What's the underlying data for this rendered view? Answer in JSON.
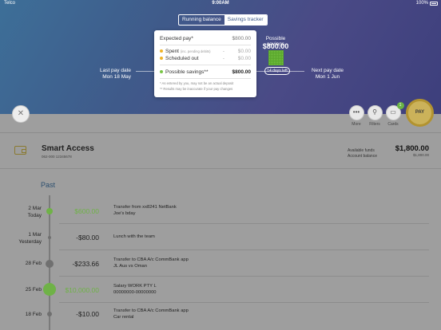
{
  "status_bar": {
    "carrier": "Telco",
    "time": "9:00AM",
    "battery": "100%"
  },
  "segments": [
    {
      "label": "Running balance"
    },
    {
      "label": "Savings tracker"
    }
  ],
  "tracker": {
    "last_pay": {
      "title": "Last pay date",
      "date": "Mon 18 May"
    },
    "next_pay": {
      "title": "Next pay date",
      "date": "Mon 1 Jun"
    },
    "days_left": "14 days left",
    "savings_title": "Possible savings",
    "savings_amount": "$800.00"
  },
  "popup": {
    "expected_pay": {
      "label": "Expected pay",
      "marker": "*",
      "value": "$800.00"
    },
    "spent": {
      "label": "Spent",
      "note": "(inc. pending debits)",
      "operator": "-",
      "value": "$0.00",
      "color": "#f0b429"
    },
    "scheduled": {
      "label": "Scheduled out",
      "operator": "-",
      "value": "$0.00",
      "color": "#f0b429"
    },
    "possible": {
      "label": "Possible savings",
      "marker": "**",
      "value": "$800.00",
      "color": "#79c545"
    },
    "note1": "* As entered by you, may not be an actual deposit",
    "note2": "** Results may be inaccurate if your pay changes"
  },
  "toolbar": {
    "more": "More",
    "filters": "Filters",
    "cards": "Cards",
    "cards_badge": "1",
    "pay": "PAY"
  },
  "account": {
    "name": "Smart Access",
    "number": "062-000 12345678",
    "available_label": "Available funds",
    "balance_label": "Account balance",
    "available": "$1,800.00",
    "balance": "$1,800.00"
  },
  "section_title": "Past",
  "transactions": [
    {
      "date": "2 Mar",
      "sub": "Today",
      "amount": "$600.00",
      "desc1": "Transfer from xx8241 NetBank",
      "desc2": "Joe's bday"
    },
    {
      "date": "1 Mar",
      "sub": "Yesterday",
      "amount": "-$80.00",
      "desc1": "Lunch with the team",
      "desc2": ""
    },
    {
      "date": "28 Feb",
      "sub": "",
      "amount": "-$233.66",
      "desc1": "Transfer to CBA A/c CommBank app",
      "desc2": "JL Aus vs Oman"
    },
    {
      "date": "25 Feb",
      "sub": "",
      "amount": "$10,000.00",
      "desc1": "Salary WORK PTY L",
      "desc2": "00000000-00000000"
    },
    {
      "date": "18 Feb",
      "sub": "",
      "amount": "-$10.00",
      "desc1": "Transfer to CBA A/c CommBank app",
      "desc2": "Car rental"
    }
  ]
}
